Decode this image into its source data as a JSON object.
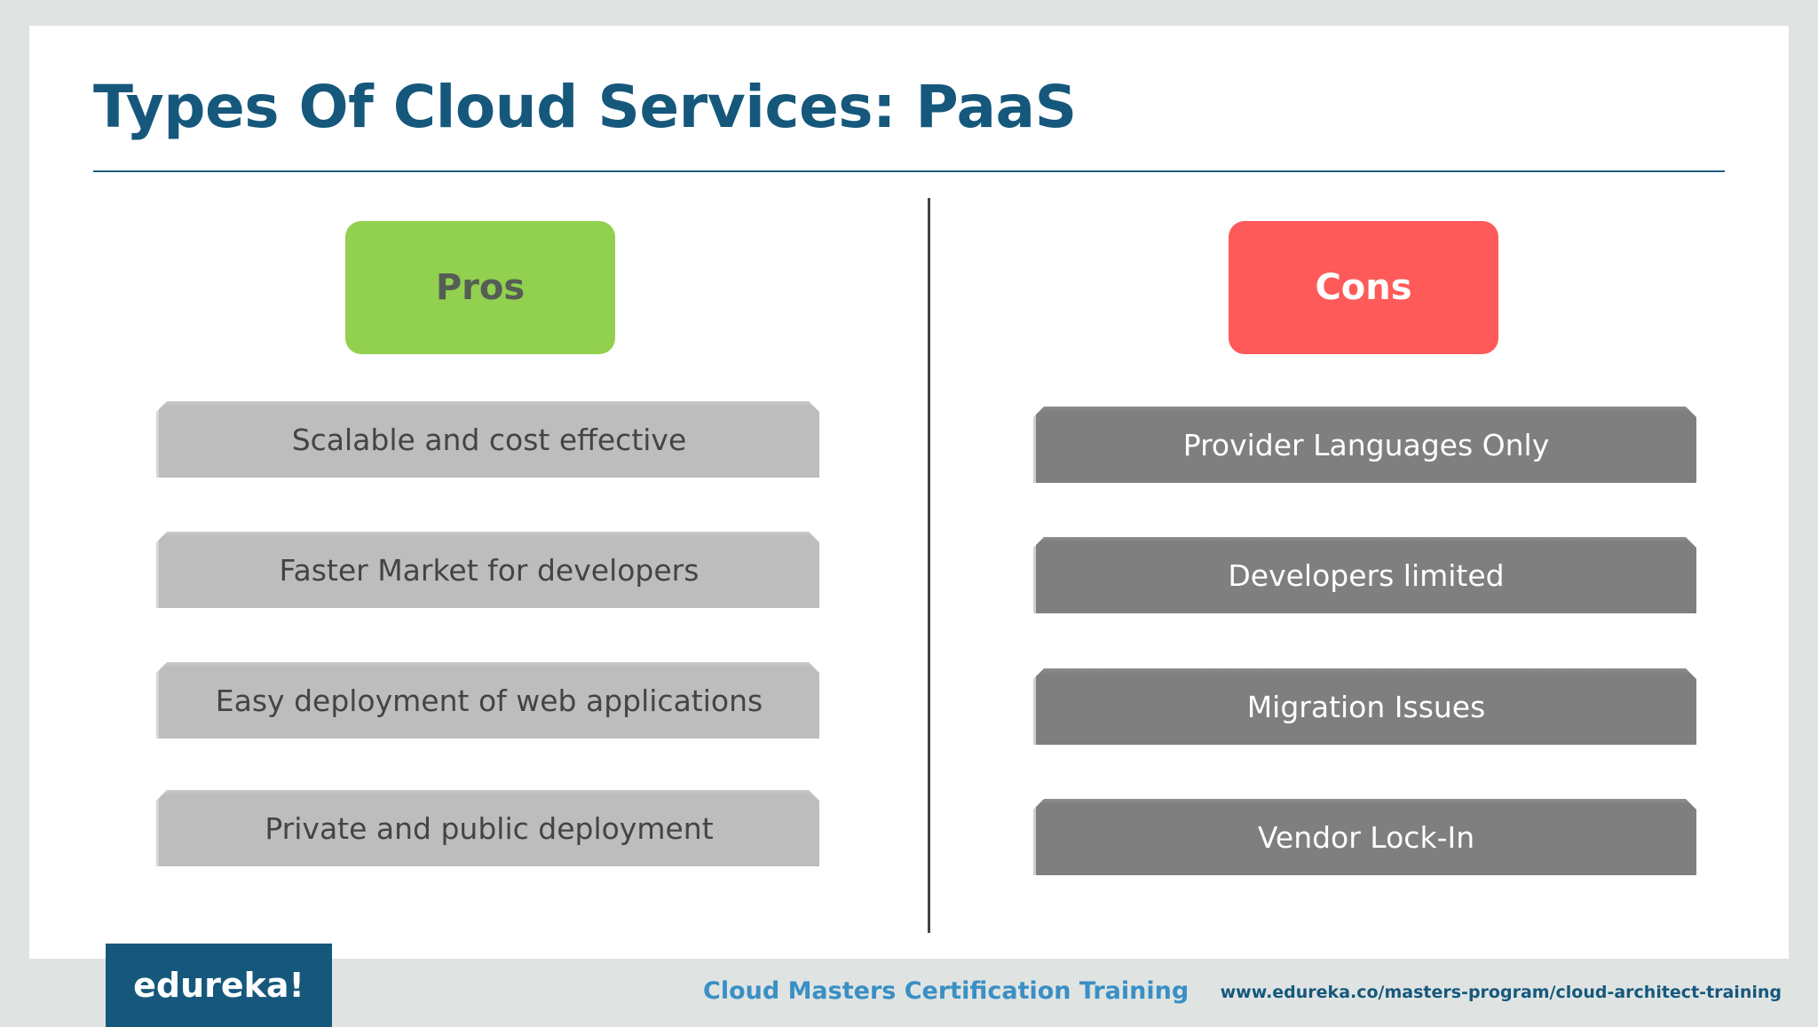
{
  "slide": {
    "title": "Types Of Cloud Services: PaaS"
  },
  "pros": {
    "heading": "Pros",
    "items": [
      "Scalable and cost effective",
      "Faster Market for developers",
      "Easy deployment of web applications",
      "Private and public deployment"
    ]
  },
  "cons": {
    "heading": "Cons",
    "items": [
      "Provider Languages Only",
      "Developers limited",
      "Migration Issues",
      "Vendor Lock-In"
    ]
  },
  "footer": {
    "logo_text": "edureka!",
    "course": "Cloud Masters Certification Training",
    "url": "www.edureka.co/masters-program/cloud-architect-training"
  },
  "colors": {
    "title": "#16587c",
    "pros_accent": "#92d050",
    "cons_accent": "#ff5a5a",
    "pro_item_fill": "#bdbdbd",
    "con_item_fill": "#7f7f7f"
  }
}
